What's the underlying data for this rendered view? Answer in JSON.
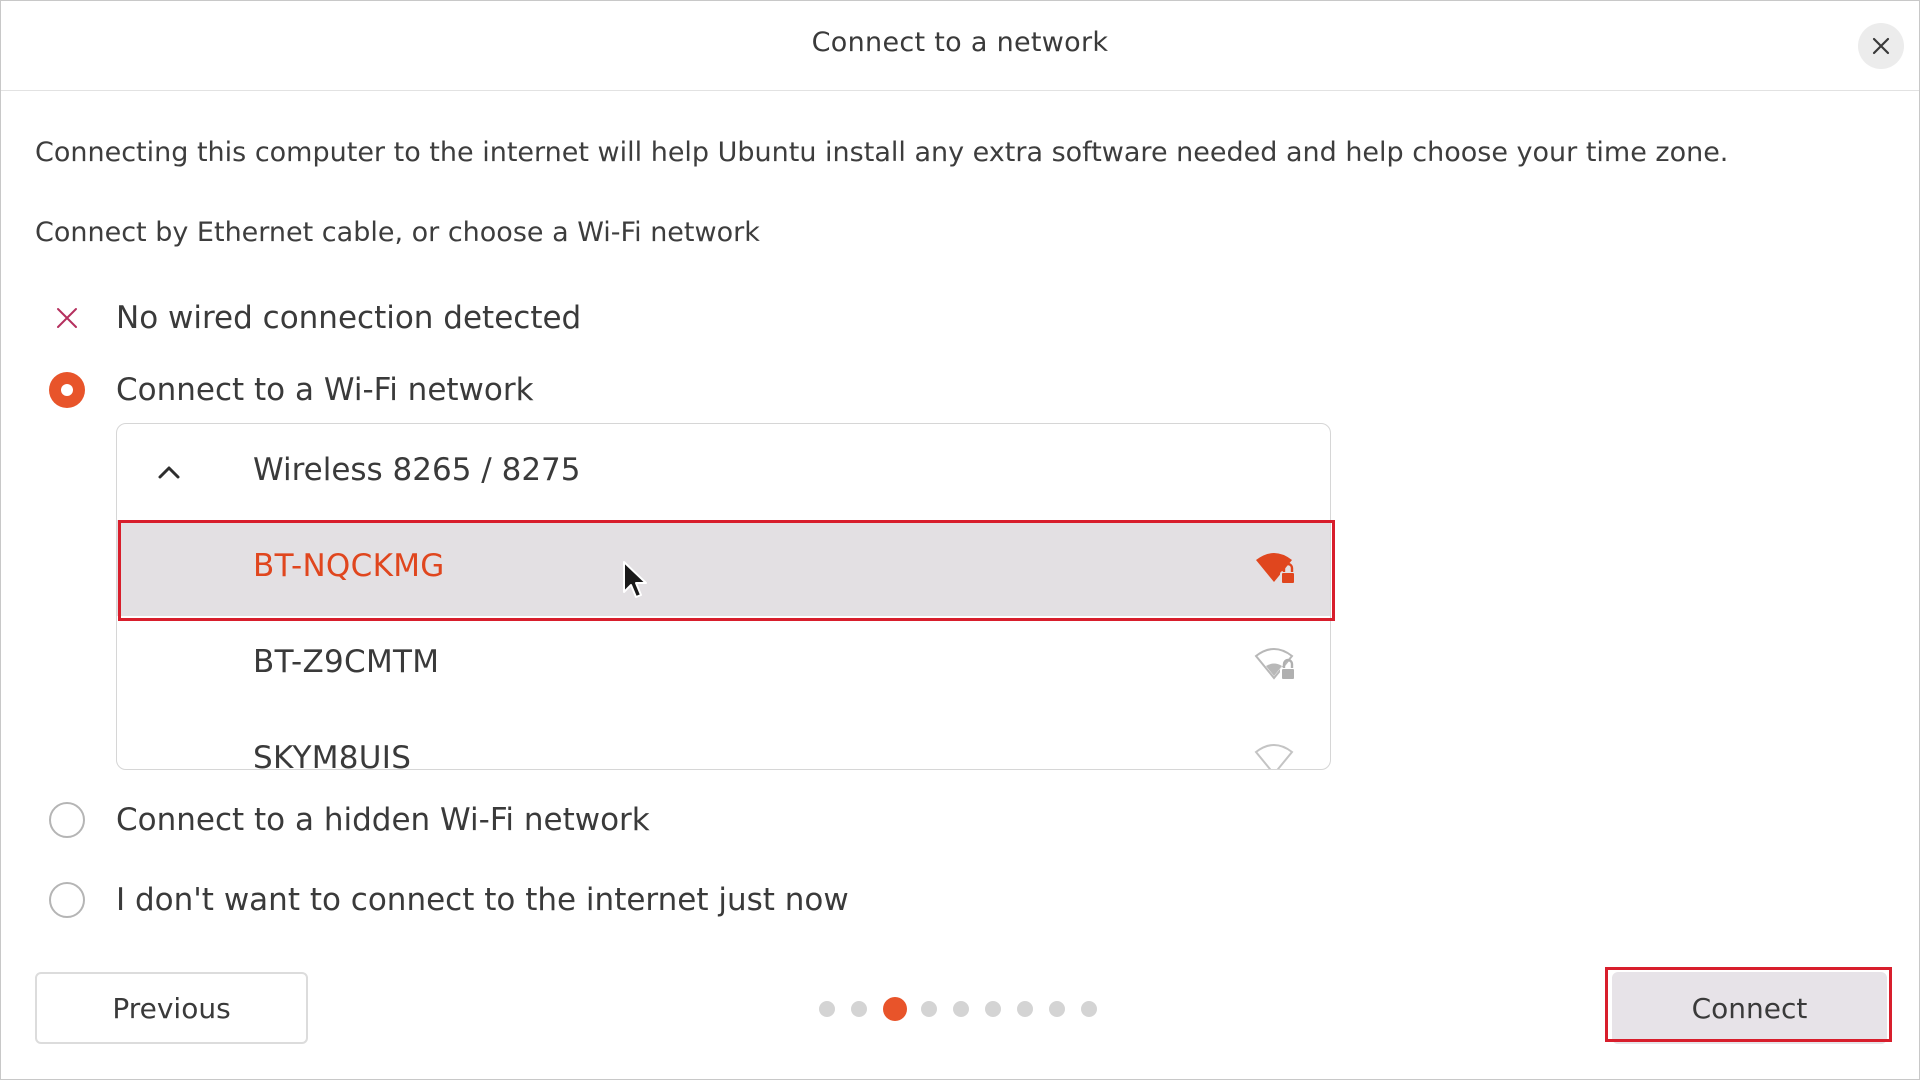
{
  "window": {
    "title": "Connect to a network",
    "close_icon": "close-icon"
  },
  "intro_text": "Connecting this computer to the internet will help Ubuntu install any extra software needed and help choose your time zone.",
  "subintro_text": "Connect by Ethernet cable, or choose a Wi-Fi network",
  "wired": {
    "icon": "x-icon",
    "label": "No wired connection detected",
    "icon_color": "#b5305e"
  },
  "options": {
    "wifi": {
      "label": "Connect to a Wi-Fi network",
      "selected": true
    },
    "hidden_wifi": {
      "label": "Connect to a hidden Wi-Fi network",
      "selected": false
    },
    "no_internet": {
      "label": "I don't want to connect to the internet just now",
      "selected": false
    }
  },
  "wifi_device": {
    "label": "Wireless 8265 / 8275",
    "expanded": true,
    "networks": [
      {
        "ssid": "BT-NQCKMG",
        "secured": true,
        "selected": true
      },
      {
        "ssid": "BT-Z9CMTM",
        "secured": true,
        "selected": false
      },
      {
        "ssid": "SKYM8UIS",
        "secured": true,
        "selected": false
      }
    ]
  },
  "footer": {
    "previous_label": "Previous",
    "connect_label": "Connect",
    "step_total": 9,
    "step_current": 3
  },
  "colors": {
    "accent": "#e8542a",
    "selected_text": "#e0461e",
    "highlight_border": "#d81e2c",
    "selected_row_bg": "#e3e0e3"
  }
}
